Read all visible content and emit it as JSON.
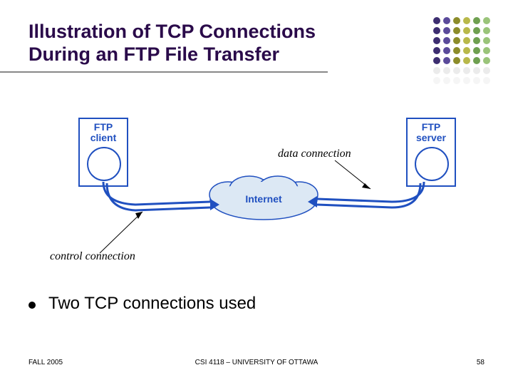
{
  "title_line1": "Illustration of TCP Connections",
  "title_line2": "During an FTP File Transfer",
  "diagram": {
    "client_label1": "FTP",
    "client_label2": "client",
    "server_label1": "FTP",
    "server_label2": "server",
    "internet_label": "Internet",
    "data_conn_label": "data connection",
    "control_conn_label": "control connection"
  },
  "bullet": "Two TCP connections used",
  "footer": {
    "left": "FALL 2005",
    "center": "CSI 4118 – UNIVERSITY OF OTTAWA",
    "right": "58"
  },
  "colors": {
    "dot_cols": [
      "#3d2e70",
      "#5a4a9a",
      "#8c8c2a",
      "#b8b84a",
      "#6fa050",
      "#9ac47a"
    ]
  }
}
